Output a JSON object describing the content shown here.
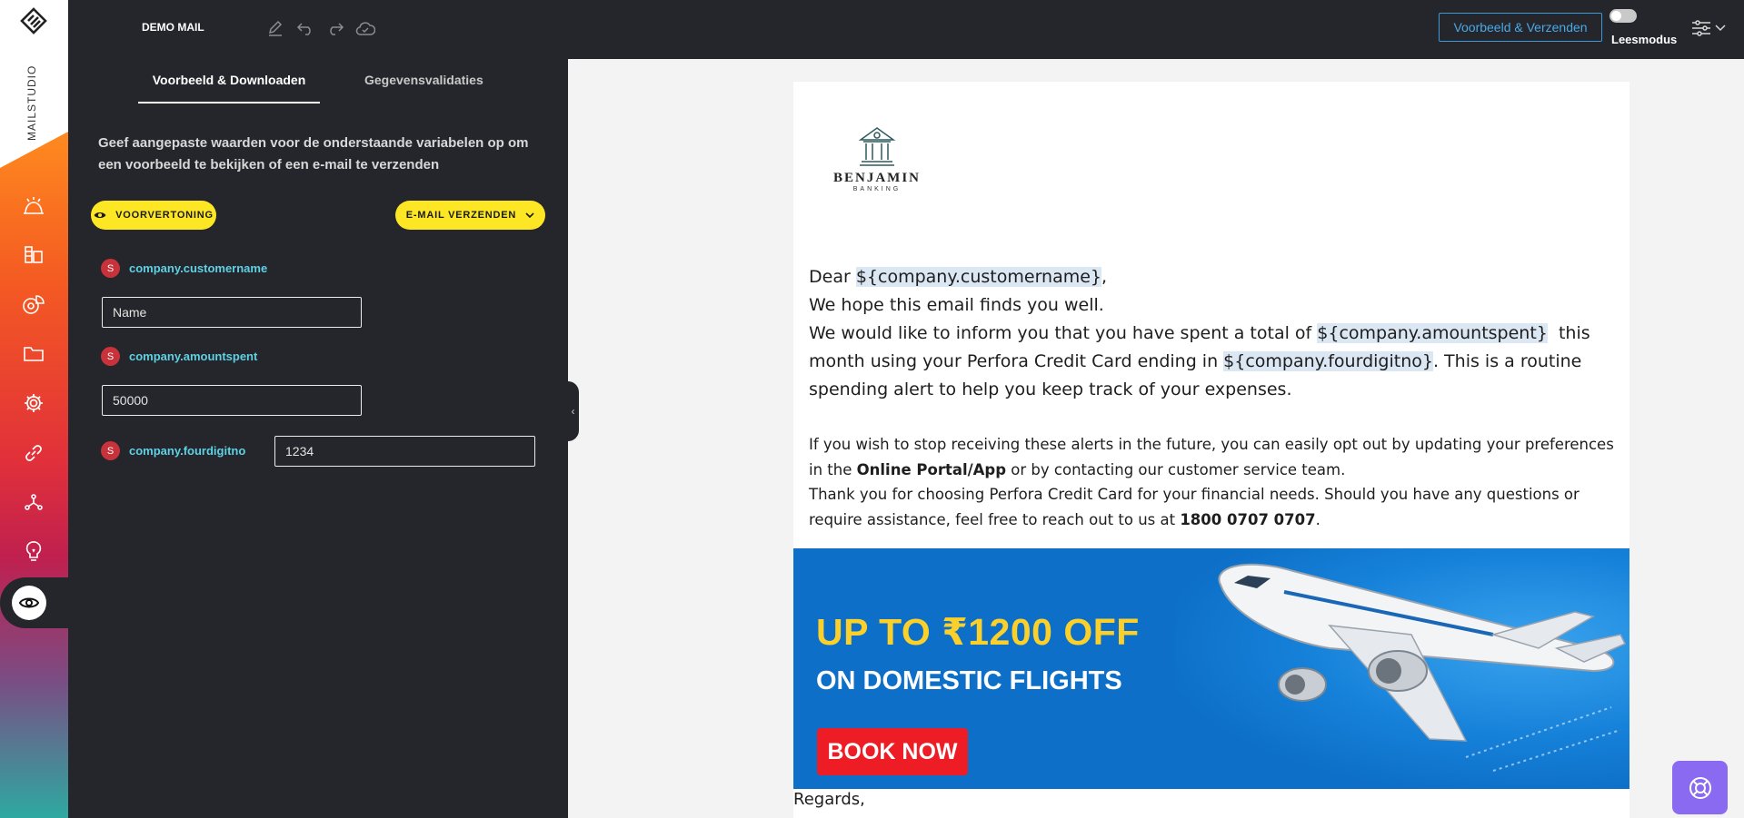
{
  "app": {
    "brand": "MAILSTUDIO",
    "doc_title": "DEMO MAIL"
  },
  "topbar": {
    "preview_send_label": "Voorbeeld & Verzenden",
    "reading_mode_label": "Leesmodus",
    "reading_mode_on": false
  },
  "panel": {
    "tabs": [
      {
        "label": "Voorbeeld & Downloaden",
        "active": true
      },
      {
        "label": "Gegevensvalidaties",
        "active": false
      }
    ],
    "description": "Geef aangepaste waarden voor de onderstaande variabelen op om een voorbeeld te bekijken of een e-mail te verzenden",
    "preview_button": "VOORVERTONING",
    "send_button": "E-MAIL VERZENDEN",
    "variables": [
      {
        "badge": "S",
        "name": "company.customername",
        "value": "Name"
      },
      {
        "badge": "S",
        "name": "company.amountspent",
        "value": "50000"
      },
      {
        "badge": "S",
        "name": "company.fourdigitno",
        "value": "1234"
      }
    ]
  },
  "email": {
    "logo_name": "BENJAMIN",
    "logo_sub": "BANKING",
    "greeting_prefix": "Dear ",
    "var_customername": "${company.customername}",
    "greeting_suffix": ",",
    "line_hope": "We hope this email finds you well.",
    "inform_prefix": "We would like to inform you that you have spent a total of ",
    "var_amountspent": "${company.amountspent}",
    "inform_mid": "  this month using your Perfora Credit Card ending in ",
    "var_fourdigitno": "${company.fourdigitno}",
    "inform_suffix": ". This is a routine spending alert to help you keep track of your expenses.",
    "optout_prefix": "If you wish to stop receiving these alerts in the future, you can easily opt out by updating your preferences in the ",
    "optout_bold": "Online Portal/App",
    "optout_suffix": " or by contacting our customer service team.",
    "thanks_prefix": "Thank you for choosing Perfora Credit Card for your financial needs. Should you have any questions or require assistance, feel free to reach out to us at ",
    "phone": "1800 0707 0707",
    "thanks_suffix": ".",
    "banner_headline": "UP TO  ₹1200 OFF",
    "banner_sub": "ON DOMESTIC FLIGHTS",
    "banner_cta": "BOOK NOW",
    "regards": "Regards,"
  },
  "colors": {
    "dark_bg": "#24262b",
    "accent_yellow": "#fde725",
    "variable_cyan": "#5fd1e5",
    "badge_red": "#c8323a",
    "link_blue": "#4aa8e8",
    "help_purple": "#8a6af0"
  },
  "icons": [
    "mailstudio-logo-icon",
    "campaign-icon",
    "analytics-icon",
    "segments-icon",
    "folder-icon",
    "settings-gear-icon",
    "link-icon",
    "integration-icon",
    "ideas-bulb-icon",
    "eye-icon",
    "pencil-icon",
    "undo-icon",
    "redo-icon",
    "cloud-check-icon",
    "sliders-icon",
    "chevron-down-icon",
    "collapse-chevron-icon",
    "bank-building-icon",
    "lifebuoy-help-icon"
  ]
}
